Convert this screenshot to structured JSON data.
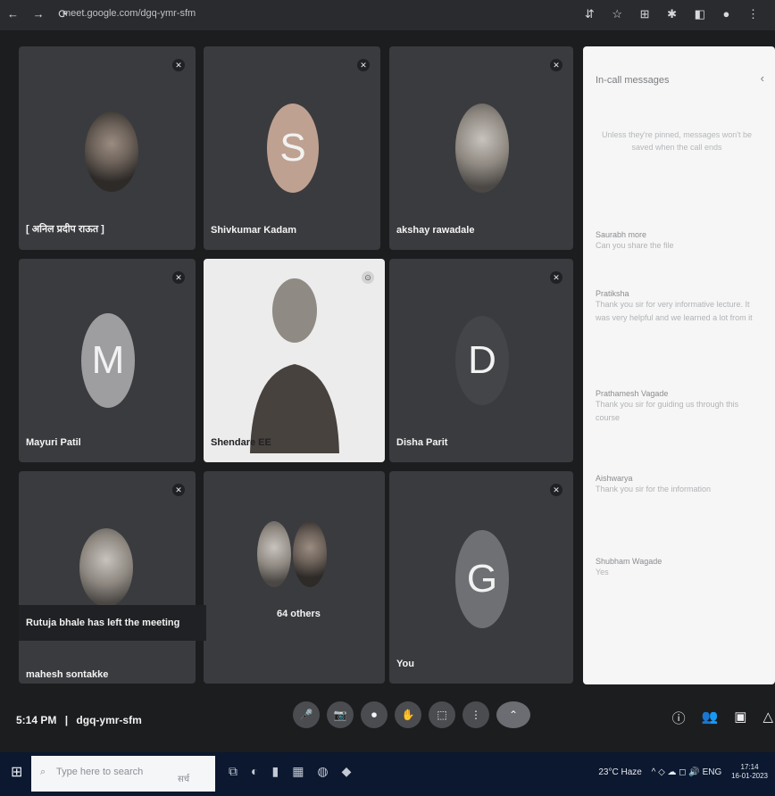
{
  "browser": {
    "nav_icons": "← → ⟳",
    "url": "meet.google.com/dgq-ymr-sfm",
    "right_icons": "⇵ ☆ ⊞ ✱ ◧ ● ⋮"
  },
  "participants": [
    {
      "name": "[ अनिल प्रदीप राऊत ]",
      "avatar_type": "photo"
    },
    {
      "name": "Shivkumar Kadam",
      "avatar_letter": "S",
      "avatar_color": "#bfa191"
    },
    {
      "name": "akshay rawadale",
      "avatar_type": "photo"
    },
    {
      "name": "Mayuri Patil",
      "avatar_letter": "M",
      "avatar_color": "#9e9ea1"
    },
    {
      "name": "Shendare EE",
      "avatar_type": "video"
    },
    {
      "name": "Disha Parit",
      "avatar_letter": "D",
      "avatar_color": "#434548"
    },
    {
      "name": "mahesh sontakke",
      "avatar_type": "photo"
    },
    {
      "name": "64 others",
      "avatar_type": "group"
    },
    {
      "name": "You",
      "avatar_letter": "G",
      "avatar_color": "#6f7073"
    }
  ],
  "toast": "Rutuja bhale has left the meeting",
  "meeting": {
    "time": "5:14 PM",
    "separator": "|",
    "code": "dgq-ymr-sfm"
  },
  "panel": {
    "title": "In-call messages",
    "close_icon": "‹",
    "info": "Unless they're pinned, messages won't be saved when the call ends",
    "messages": [
      {
        "sender": "Saurabh more",
        "text": "Can you share the file"
      },
      {
        "sender": "Pratiksha",
        "text": "Thank you sir for very informative lecture. It was very helpful and we learned a lot from it"
      },
      {
        "sender": "Prathamesh Vagade",
        "text": "Thank you sir for guiding us through this course"
      },
      {
        "sender": "Aishwarya",
        "text": "Thank you sir for the information"
      },
      {
        "sender": "Shubham Wagade",
        "text": "Yes"
      }
    ]
  },
  "controls": {
    "icons": [
      "🎤",
      "📷",
      "⏺",
      "✋",
      "⬚",
      "⋮",
      "⌃"
    ],
    "right_icons": [
      "ⓘ",
      "👥",
      "▣",
      "△"
    ]
  },
  "taskbar": {
    "start": "⊞",
    "search_placeholder": "Type here to search",
    "search_hint": "सर्च",
    "apps": [
      "⧉",
      "◐",
      "▮",
      "▦",
      "◍",
      "◆"
    ],
    "weather": "23°C Haze",
    "tray_icons": "^ ◇ ☁ ◻ 🔊 ENG",
    "clock": "17:14",
    "date": "16-01-2023"
  }
}
